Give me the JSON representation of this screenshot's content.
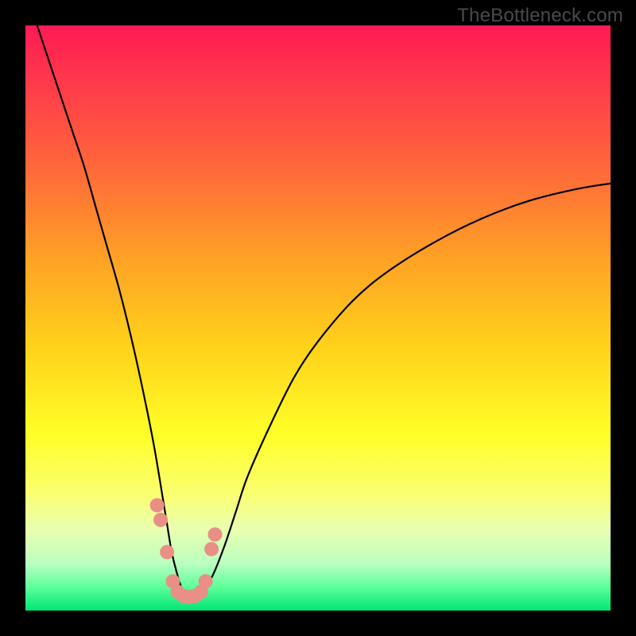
{
  "watermark": "TheBottleneck.com",
  "chart_data": {
    "type": "line",
    "title": "",
    "xlabel": "",
    "ylabel": "",
    "xlim": [
      0,
      100
    ],
    "ylim": [
      0,
      100
    ],
    "grid": false,
    "legend": null,
    "annotations": [],
    "series": [
      {
        "name": "bottleneck-curve",
        "x": [
          2,
          4,
          6,
          8,
          10,
          12,
          14,
          16,
          18,
          20,
          22,
          24,
          25,
          26,
          27,
          28,
          29,
          30,
          32,
          34,
          36,
          38,
          42,
          46,
          50,
          56,
          62,
          70,
          78,
          86,
          94,
          100
        ],
        "y": [
          100,
          94,
          88,
          82,
          76,
          69,
          62,
          55,
          47,
          38,
          28,
          16,
          10,
          6,
          3,
          2,
          2,
          3,
          6,
          11,
          17,
          23,
          32,
          40,
          46,
          53,
          58,
          63,
          67,
          70,
          72,
          73
        ]
      }
    ],
    "markers": [
      {
        "name": "left-dots",
        "x": [
          22.5,
          23.1,
          24.2
        ],
        "y": [
          18,
          15.5,
          10
        ]
      },
      {
        "name": "valley-dots",
        "x": [
          25.2,
          26.0,
          27.0,
          28.0,
          29.0,
          30.0,
          30.8
        ],
        "y": [
          5,
          3.2,
          2.5,
          2.3,
          2.5,
          3.2,
          5
        ]
      },
      {
        "name": "right-dots",
        "x": [
          31.8,
          32.4
        ],
        "y": [
          10.5,
          13
        ]
      }
    ],
    "colors": {
      "curve": "#000000",
      "marker": "#e98f86"
    }
  }
}
